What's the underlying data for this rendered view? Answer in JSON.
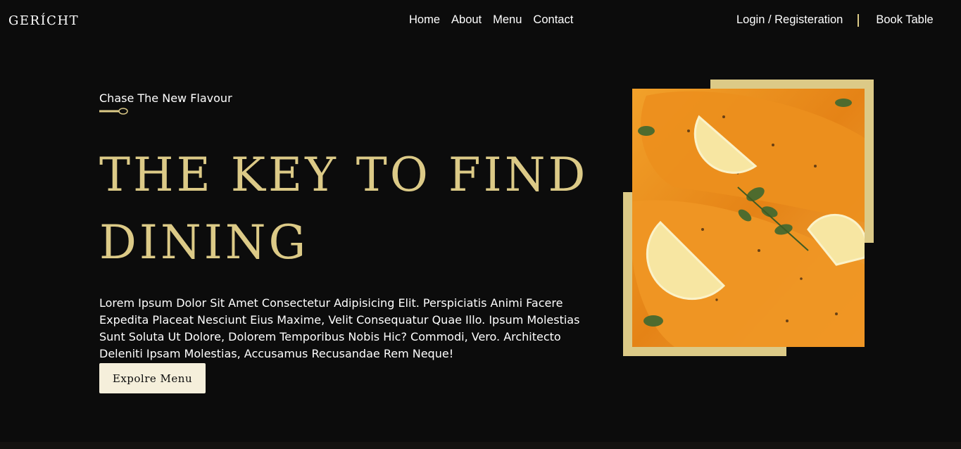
{
  "brand": {
    "logo": "GERÍCHT"
  },
  "nav": {
    "links": [
      "Home",
      "About",
      "Menu",
      "Contact"
    ],
    "login": "Login / Registeration",
    "book_table": "Book Table"
  },
  "hero": {
    "subtitle": "Chase The New Flavour",
    "title_line1": "THE KEY TO FIND",
    "title_line2": "DINING",
    "description": "Lorem Ipsum Dolor Sit Amet Consectetur Adipisicing Elit. Perspiciatis Animi Facere Expedita Placeat Nesciunt Eius Maxime, Velit Consequatur Quae Illo. Ipsum Molestias Sunt Soluta Ut Dolore, Dolorem Temporibus Nobis Hic? Commodi, Vero. Architecto Deleniti Ipsam Molestias, Accusamus Recusandae Rem Neque!",
    "button_label": "Expolre Menu"
  },
  "icons": {
    "spoon": "spoon-icon"
  },
  "colors": {
    "background": "#0c0c0c",
    "accent": "#dcca87",
    "button_bg": "#f5efdb",
    "text": "#ffffff"
  }
}
